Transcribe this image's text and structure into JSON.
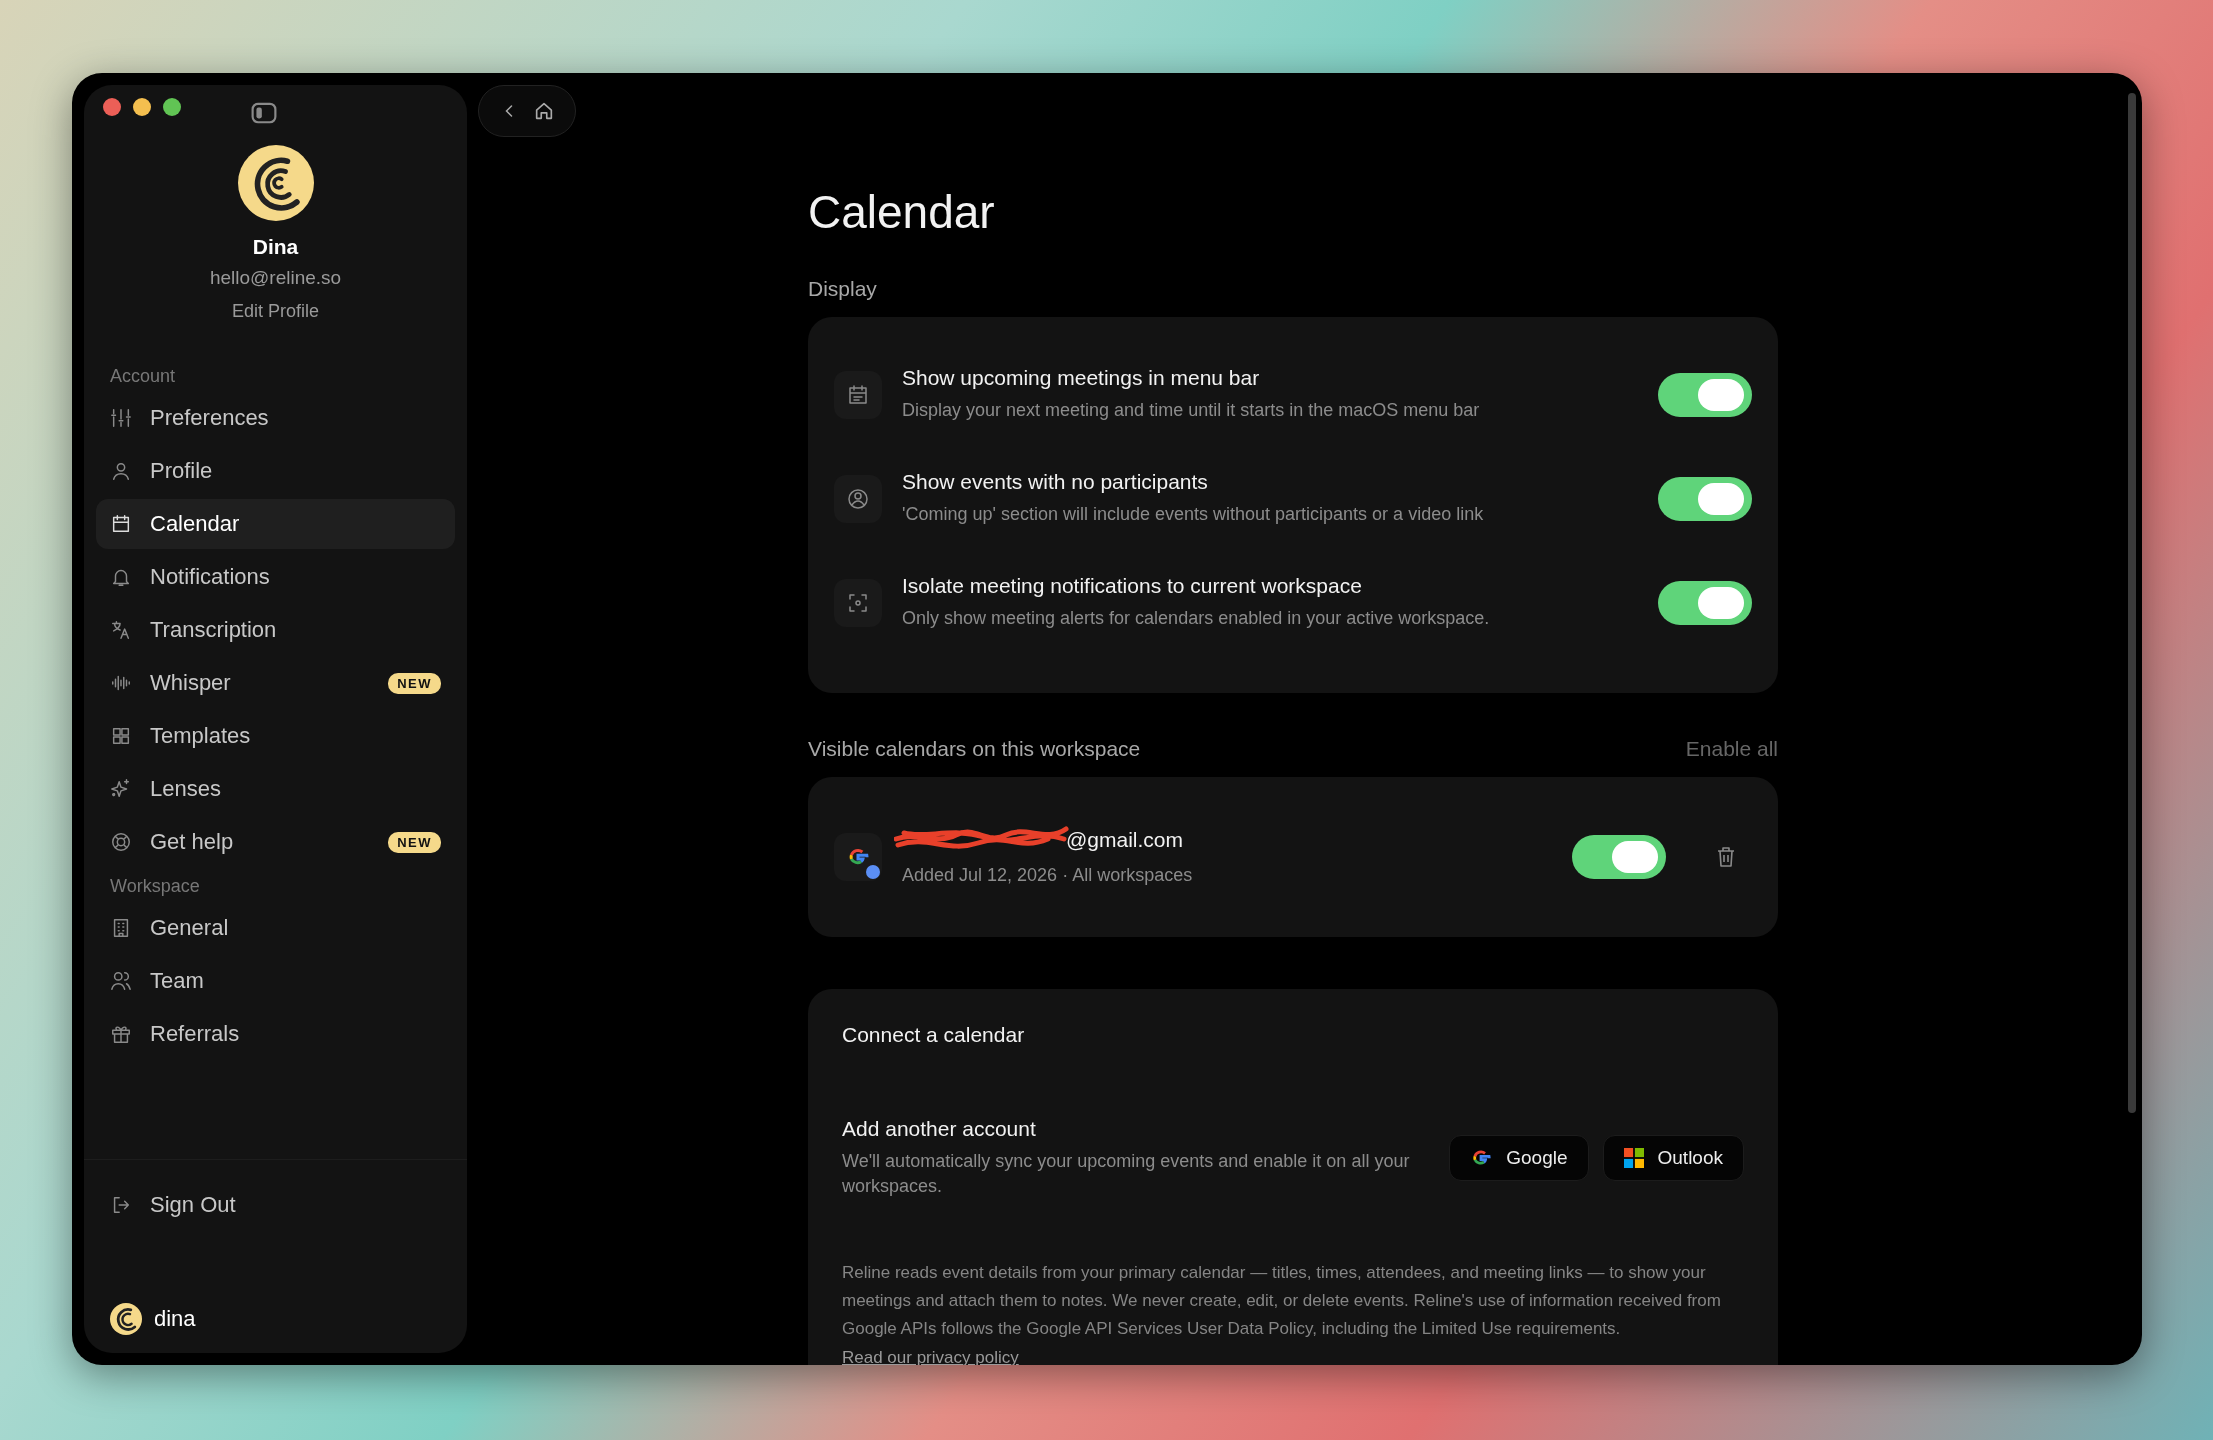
{
  "window": {
    "controls": [
      {
        "color": "#ec5f57"
      },
      {
        "color": "#f4bf4f"
      },
      {
        "color": "#61c454"
      }
    ]
  },
  "profile": {
    "name": "Dina",
    "email": "hello@reline.so",
    "edit": "Edit Profile"
  },
  "sidebar": {
    "sections": [
      {
        "title": "Account",
        "items": [
          {
            "label": "Preferences",
            "selected": false
          },
          {
            "label": "Profile",
            "selected": false
          },
          {
            "label": "Calendar",
            "selected": true
          },
          {
            "label": "Notifications",
            "selected": false
          },
          {
            "label": "Transcription",
            "selected": false
          },
          {
            "label": "Whisper",
            "selected": false,
            "badge": "NEW"
          },
          {
            "label": "Templates",
            "selected": false
          },
          {
            "label": "Lenses",
            "selected": false
          },
          {
            "label": "Get help",
            "selected": false,
            "badge": "NEW"
          }
        ]
      },
      {
        "title": "Workspace",
        "items": [
          {
            "label": "General",
            "selected": false
          },
          {
            "label": "Team",
            "selected": false
          },
          {
            "label": "Referrals",
            "selected": false
          }
        ]
      }
    ],
    "sign_out": "Sign Out",
    "user": "dina"
  },
  "main": {
    "title": "Calendar",
    "display": {
      "label": "Display",
      "settings": [
        {
          "title": "Show upcoming meetings in menu bar",
          "description": "Display your next meeting and time until it starts in the macOS menu bar",
          "on": true
        },
        {
          "title": "Show events with no participants",
          "description": "'Coming up' section will include events without participants or a video link",
          "on": true
        },
        {
          "title": "Isolate meeting notifications to current workspace",
          "description": "Only show meeting alerts for calendars enabled in your active workspace.",
          "on": true
        }
      ]
    },
    "calendars": {
      "label": "Visible calendars on this workspace",
      "action": "Enable all",
      "items": [
        {
          "account": "@gmail.com",
          "meta": "Added Jul 12, 2026 · All workspaces",
          "on": true
        }
      ]
    },
    "connect": {
      "title": "Connect a calendar",
      "subtitle": "Add another account",
      "description": "We'll automatically sync your upcoming events and enable it on all your workspaces.",
      "buttons": [
        "Google",
        "Outlook"
      ],
      "notice": "Reline reads event details from your primary calendar — titles, times, attendees, and meeting links — to show your meetings and attach them to notes. We never create, edit, or delete events. Reline's use of information received from Google APIs follows the Google API Services User Data Policy, including the Limited Use requirements.",
      "link": "Read our privacy policy"
    }
  }
}
